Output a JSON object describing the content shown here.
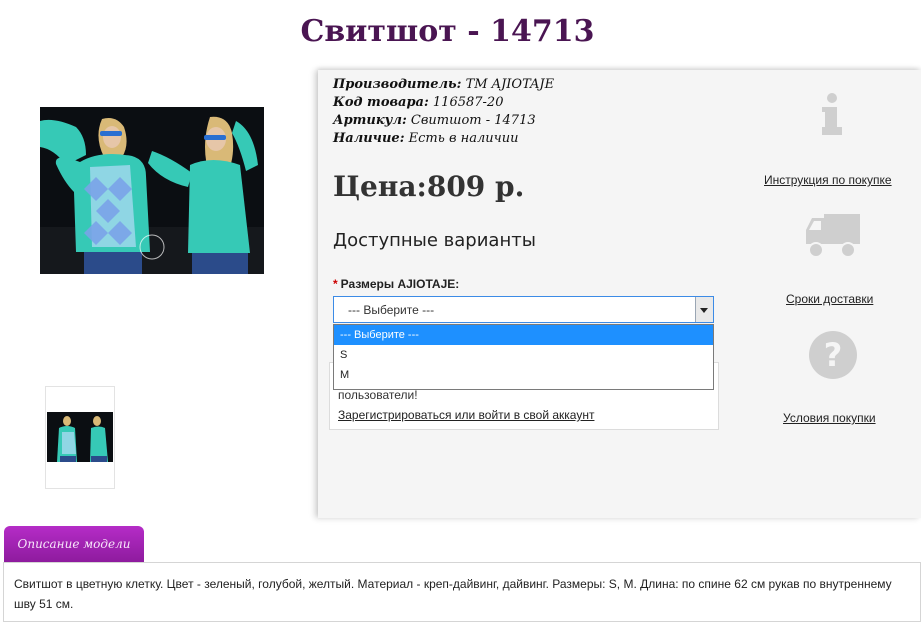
{
  "product": {
    "title": "Свитшот - 14713",
    "info": {
      "manufacturer_label": "Производитель:",
      "manufacturer_value": "ТМ AJIOTAJE",
      "code_label": "Код товара:",
      "code_value": "116587-20",
      "article_label": "Артикул:",
      "article_value": "Свитшот - 14713",
      "stock_label": "Наличие:",
      "stock_value": "Есть в наличии"
    },
    "price": "Цена:809 р.",
    "variants_heading": "Доступные варианты",
    "size_field": {
      "required_mark": "*",
      "label": "Размеры AJIOTAJE:",
      "selected": "--- Выберите ---",
      "options": [
        "--- Выберите ---",
        "S",
        "M"
      ]
    },
    "login": {
      "text": "пользователи!",
      "link": "Зарегистрироваться или войти в свой аккаунт"
    }
  },
  "sidebar": {
    "purchase_instructions": "Инструкция по покупке",
    "delivery_terms": "Сроки доставки",
    "purchase_conditions": "Условия покупки"
  },
  "description": {
    "tab_label": "Описание модели",
    "text": "Свитшот в цветную клетку. Цвет - зеленый, голубой, желтый. Материал - креп-дайвинг, дайвинг. Размеры: S, M. Длина: по спине 62 см рукав по внутреннему шву 51 см."
  },
  "colors": {
    "title": "#4a1552",
    "tab": "#a323b5",
    "dropdown_highlight": "#1e90ff",
    "icon_gray": "#cfcfcf"
  }
}
